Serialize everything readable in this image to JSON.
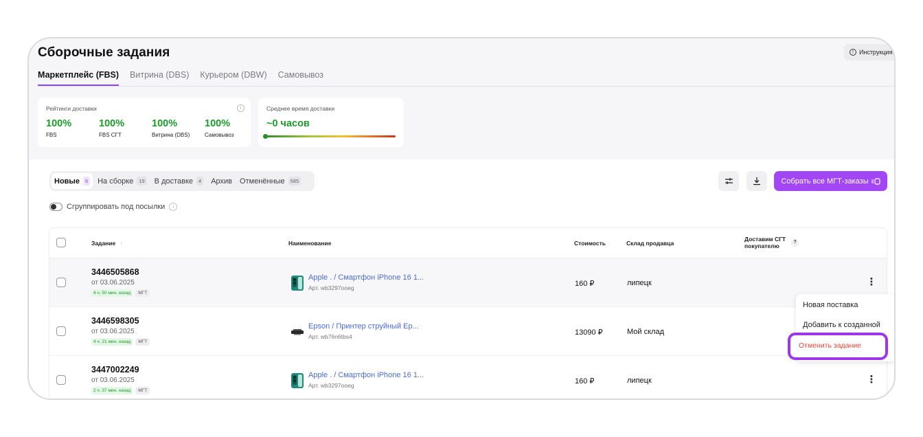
{
  "page": {
    "title": "Сборочные задания",
    "instruction_button": "Инструкция"
  },
  "tabs": [
    {
      "label": "Маркетплейс (FBS)",
      "active": true
    },
    {
      "label": "Витрина (DBS)",
      "active": false
    },
    {
      "label": "Курьером (DBW)",
      "active": false
    },
    {
      "label": "Самовывоз",
      "active": false
    }
  ],
  "ratings": {
    "label": "Рейтинги доставки",
    "items": [
      {
        "value": "100%",
        "label": "FBS"
      },
      {
        "value": "100%",
        "label": "FBS СГТ"
      },
      {
        "value": "100%",
        "label": "Витрина (DBS)"
      },
      {
        "value": "100%",
        "label": "Самовывоз"
      }
    ]
  },
  "delivery_time": {
    "label": "Среднее время доставки",
    "value": "~0 часов"
  },
  "status_tabs": [
    {
      "label": "Новые",
      "count": "6",
      "active": true
    },
    {
      "label": "На сборке",
      "count": "19",
      "active": false
    },
    {
      "label": "В доставке",
      "count": "4",
      "active": false
    },
    {
      "label": "Архив",
      "count": "",
      "active": false
    },
    {
      "label": "Отменённые",
      "count": "585",
      "active": false
    }
  ],
  "actions": {
    "primary": "Собрать все МГТ-заказы"
  },
  "group_toggle_label": "Сгруппировать под посылки",
  "table": {
    "headers": {
      "task": "Задание",
      "name": "Наименование",
      "price": "Стоимость",
      "warehouse": "Склад продавца",
      "delivery_line1": "Доставим СГТ",
      "delivery_line2": "покупателю"
    },
    "rows": [
      {
        "id": "3446505868",
        "date": "от 03.06.2025",
        "age": "4 ч. 50 мин. назад",
        "tag": "МГТ",
        "product": "Apple . / Смартфон iPhone 16 1...",
        "article": "Арт. wb3297ooeg",
        "price": "160 ₽",
        "warehouse": "липецк",
        "thumb": "phone"
      },
      {
        "id": "3446598305",
        "date": "от 03.06.2025",
        "age": "4 ч. 21 мин. назад",
        "tag": "МГТ",
        "product": "Epson / Принтер струйный Ep...",
        "article": "Арт. wb76n6tbs4",
        "price": "13090 ₽",
        "warehouse": "Мой склад",
        "thumb": "printer"
      },
      {
        "id": "3447002249",
        "date": "от 03.06.2025",
        "age": "2 ч. 37 мин. назад",
        "tag": "МГТ",
        "product": "Apple . / Смартфон iPhone 16 1...",
        "article": "Арт. wb3297ooeg",
        "price": "160 ₽",
        "warehouse": "липецк",
        "thumb": "phone"
      }
    ]
  },
  "context_menu": {
    "items": [
      "Новая поставка",
      "Добавить к созданной",
      "Отменить задание"
    ]
  },
  "colors": {
    "accent": "#a346f5",
    "green": "#1c9b2a",
    "link": "#4b6cd8",
    "danger": "#e8493a",
    "highlight": "#9e37e8"
  }
}
